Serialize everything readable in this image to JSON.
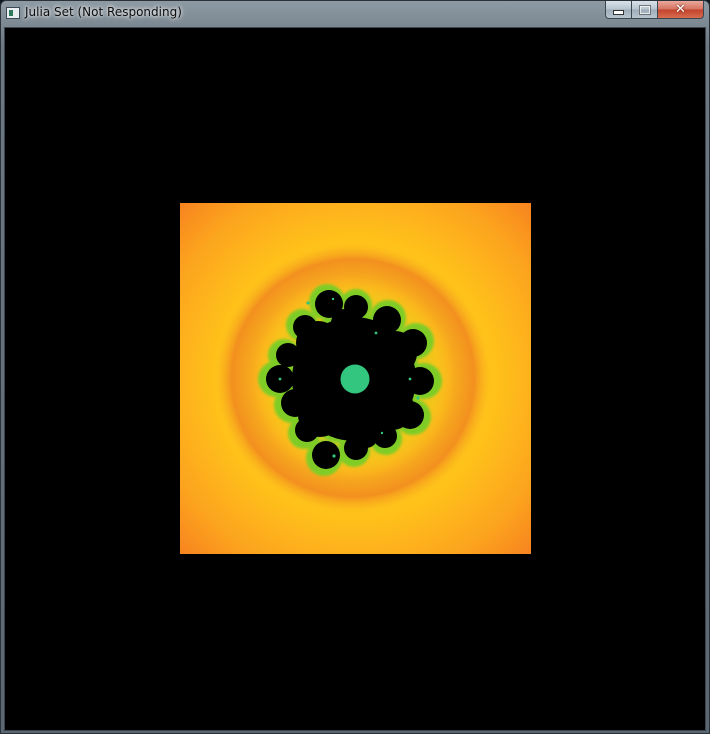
{
  "window": {
    "title": "Julia Set (Not Responding)",
    "icons": {
      "app": "app-icon",
      "minimize": "minimize-icon",
      "maximize": "maximize-icon",
      "close": "close-icon"
    },
    "close_glyph": "✕"
  },
  "canvas": {
    "background": "#000000",
    "colors": {
      "outer": "#f7801f",
      "mid": "#ffc61a",
      "inner_ring": "#f3901f",
      "edge": "#8acd24",
      "set": "#000000",
      "center": "#33c67e"
    }
  }
}
